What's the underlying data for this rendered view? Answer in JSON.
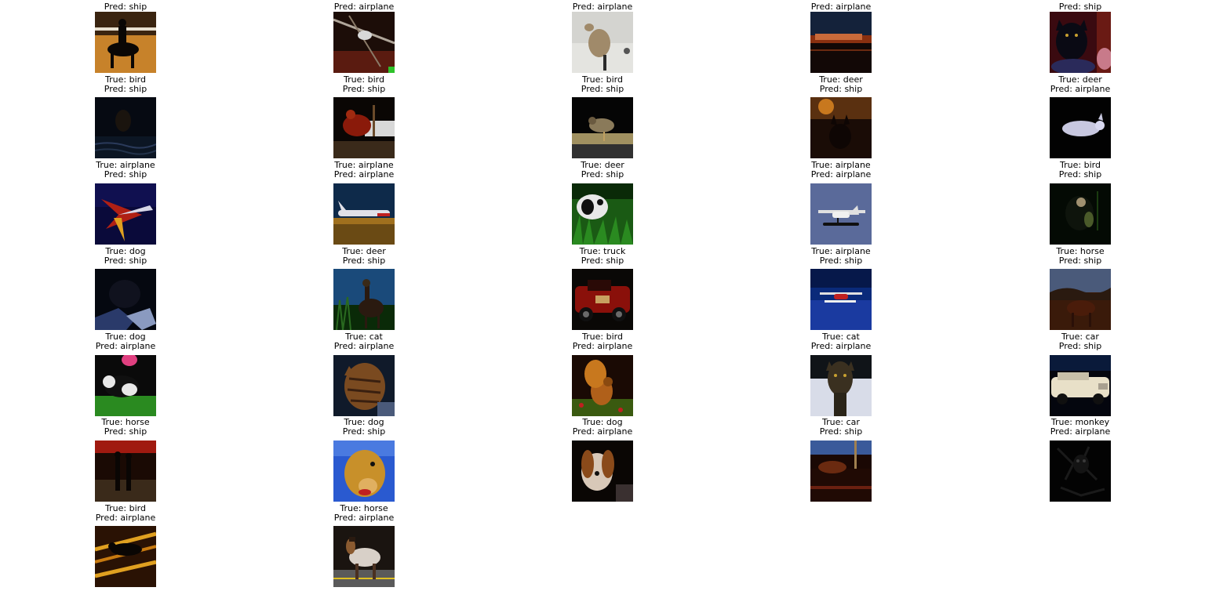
{
  "cells": [
    {
      "pred": "Pred: ship",
      "thumb": "rider-on-horse"
    },
    {
      "pred": "Pred: airplane",
      "thumb": "bird-on-branch"
    },
    {
      "pred": "Pred: airplane",
      "thumb": "greyhound"
    },
    {
      "pred": "Pred: airplane",
      "thumb": "ship-at-dusk"
    },
    {
      "pred": "Pred: ship",
      "thumb": "cat-on-lap"
    },
    {
      "true": "True: bird",
      "pred": "Pred: ship",
      "thumb": "dark-bird-water"
    },
    {
      "true": "True: bird",
      "pred": "Pred: ship",
      "thumb": "red-bird"
    },
    {
      "true": "True: bird",
      "pred": "Pred: ship",
      "thumb": "bird-on-post"
    },
    {
      "true": "True: deer",
      "pred": "Pred: ship",
      "thumb": "deer-silhouette"
    },
    {
      "true": "True: deer",
      "pred": "Pred: airplane",
      "thumb": "white-animal"
    },
    {
      "true": "True: airplane",
      "pred": "Pred: ship",
      "thumb": "red-plane"
    },
    {
      "true": "True: airplane",
      "pred": "Pred: airplane",
      "thumb": "jet-on-field"
    },
    {
      "true": "True: deer",
      "pred": "Pred: ship",
      "thumb": "dog-in-grass"
    },
    {
      "true": "True: airplane",
      "pred": "Pred: airplane",
      "thumb": "seaplane-sky"
    },
    {
      "true": "True: bird",
      "pred": "Pred: ship",
      "thumb": "owl-dark"
    },
    {
      "true": "True: dog",
      "pred": "Pred: ship",
      "thumb": "dark-dog"
    },
    {
      "true": "True: deer",
      "pred": "Pred: ship",
      "thumb": "deer-in-grass"
    },
    {
      "true": "True: truck",
      "pred": "Pred: ship",
      "thumb": "red-truck"
    },
    {
      "true": "True: airplane",
      "pred": "Pred: ship",
      "thumb": "seaplane-water"
    },
    {
      "true": "True: horse",
      "pred": "Pred: ship",
      "thumb": "horse-dusk"
    },
    {
      "true": "True: dog",
      "pred": "Pred: airplane",
      "thumb": "dog-on-lawn"
    },
    {
      "true": "True: cat",
      "pred": "Pred: airplane",
      "thumb": "tabby-cat"
    },
    {
      "true": "True: bird",
      "pred": "Pred: airplane",
      "thumb": "squirrel-bird"
    },
    {
      "true": "True: cat",
      "pred": "Pred: airplane",
      "thumb": "cat-in-snow"
    },
    {
      "true": "True: car",
      "pred": "Pred: ship",
      "thumb": "white-limo"
    },
    {
      "true": "True: horse",
      "pred": "Pred: ship",
      "thumb": "horse-riders"
    },
    {
      "true": "True: dog",
      "pred": "Pred: ship",
      "thumb": "golden-dog"
    },
    {
      "true": "True: dog",
      "pred": "Pred: airplane",
      "thumb": "beagle"
    },
    {
      "true": "True: car",
      "pred": "Pred: ship",
      "thumb": "car-street"
    },
    {
      "true": "True: monkey",
      "pred": "Pred: airplane",
      "thumb": "dark-monkey"
    },
    {
      "true": "True: bird",
      "pred": "Pred: airplane",
      "thumb": "bird-yellow"
    },
    {
      "true": "True: horse",
      "pred": "Pred: airplane",
      "thumb": "pony-road"
    }
  ]
}
